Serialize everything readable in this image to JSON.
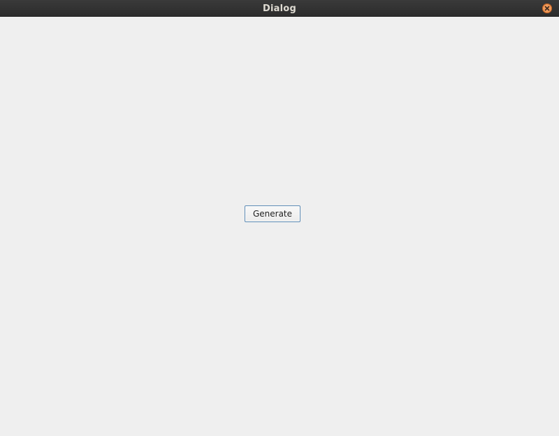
{
  "window": {
    "title": "Dialog",
    "close_icon": "close-icon",
    "colors": {
      "titlebar": "#2c2c2c",
      "title_text": "#dfdbd2",
      "close_button": "#f09a5a",
      "background": "#efefef",
      "button_border": "#5d8bb5"
    }
  },
  "main": {
    "generate_label": "Generate"
  }
}
